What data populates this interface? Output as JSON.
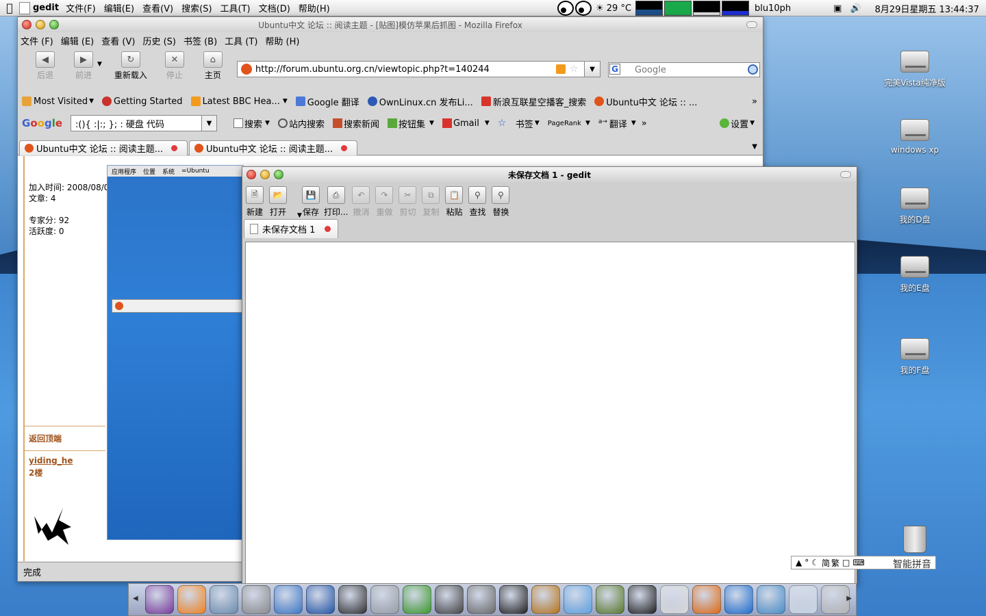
{
  "top_panel": {
    "app_name": "gedit",
    "menus": [
      "文件(F)",
      "编辑(E)",
      "查看(V)",
      "搜索(S)",
      "工具(T)",
      "文档(D)",
      "帮助(H)"
    ],
    "weather": "29 °C",
    "username": "blu10ph",
    "clock": "8月29日星期五 13:44:37"
  },
  "firefox": {
    "title": "Ubuntu中文 论坛 :: 阅读主题 - [贴图]模仿苹果后抓图 - Mozilla Firefox",
    "menus": [
      "文件 (F)",
      "编辑 (E)",
      "查看 (V)",
      "历史 (S)",
      "书签 (B)",
      "工具 (T)",
      "帮助 (H)"
    ],
    "nav": {
      "back": "后退",
      "forward": "前进",
      "reload": "重新载入",
      "stop": "停止",
      "home": "主页"
    },
    "url": "http://forum.ubuntu.org.cn/viewtopic.php?t=140244",
    "search_placeholder": "Google",
    "bookmarks": [
      {
        "label": "Most Visited",
        "color": "#e8a23a"
      },
      {
        "label": "Getting Started",
        "color": "#c8332b"
      },
      {
        "label": "Latest BBC Hea...",
        "color": "#f39a1d"
      },
      {
        "label": "Google 翻译",
        "color": "#4b79d8"
      },
      {
        "label": "OwnLinux.cn 发布Li...",
        "color": "#2b59b4"
      },
      {
        "label": "新浪互联星空播客_搜索",
        "color": "#d8332b"
      },
      {
        "label": "Ubuntu中文 论坛 :: ...",
        "color": "#e0541c"
      }
    ],
    "google_toolbar": {
      "query": ":(){ :|:; }; :  硬盘 代码",
      "buttons": [
        "搜索",
        "站内搜索",
        "搜索新闻",
        "按钮集",
        "Gmail",
        "书签",
        "PageRank",
        "翻译"
      ],
      "settings": "设置"
    },
    "tabs": [
      "Ubuntu中文 论坛 :: 阅读主题...",
      "Ubuntu中文 论坛 :: 阅读主题..."
    ],
    "post": {
      "join_time": "加入时间: 2008/08/0",
      "articles": "文章: 4",
      "expert_score": "专家分: 92",
      "activity": "活跃度: 0",
      "back_to_top": "返回顶端",
      "username": "yiding_he",
      "floor": "2楼"
    },
    "inner_shot": {
      "panel_items": [
        "应用程序",
        "位置",
        "系统"
      ],
      "tab_label": "=Ubuntu"
    },
    "status": "完成"
  },
  "gedit": {
    "title": "未保存文档 1 - gedit",
    "toolbar": [
      {
        "label": "新建",
        "enabled": true,
        "icon": "new-doc-icon"
      },
      {
        "label": "打开",
        "enabled": true,
        "icon": "open-folder-icon"
      },
      {
        "label": "保存",
        "enabled": true,
        "icon": "save-icon"
      },
      {
        "label": "打印...",
        "enabled": true,
        "icon": "print-icon"
      },
      {
        "label": "撤消",
        "enabled": false,
        "icon": "undo-icon"
      },
      {
        "label": "重做",
        "enabled": false,
        "icon": "redo-icon"
      },
      {
        "label": "剪切",
        "enabled": false,
        "icon": "cut-icon"
      },
      {
        "label": "复制",
        "enabled": false,
        "icon": "copy-icon"
      },
      {
        "label": "粘贴",
        "enabled": true,
        "icon": "paste-icon"
      },
      {
        "label": "查找",
        "enabled": true,
        "icon": "find-icon"
      },
      {
        "label": "替换",
        "enabled": true,
        "icon": "replace-icon"
      }
    ],
    "tab": "未保存文档 1",
    "text": ""
  },
  "desktop_icons": [
    "完美Vista纯净版",
    "windows xp",
    "我的D盘",
    "我的E盘",
    "我的F盘"
  ],
  "ime": {
    "label": "智能拼音",
    "mode_chars": [
      "简",
      "繁"
    ]
  },
  "dock_colors": [
    "#7a3b9c",
    "#f3851f",
    "#6c8fb0",
    "#8d8d8d",
    "#3d79c9",
    "#2456a8",
    "#333333",
    "#9aa0a6",
    "#3b9b2a",
    "#444444",
    "#6b6b6b",
    "#222222",
    "#b8761e",
    "#5ea3e3",
    "#5a7a2a",
    "#222222",
    "#d9d9d9",
    "#e36b14",
    "#1f6fd1",
    "#4a8fc9",
    "#c9d6e3",
    "#b5b5b5"
  ]
}
